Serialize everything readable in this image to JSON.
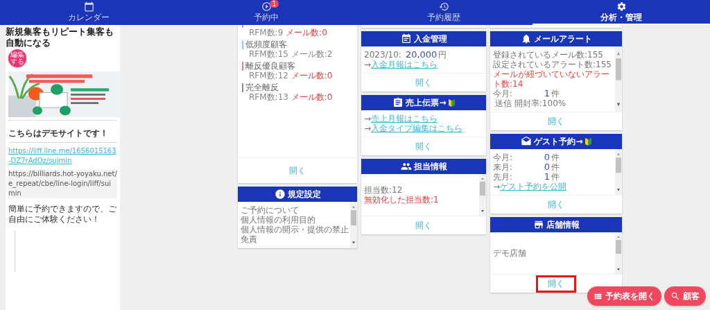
{
  "nav": {
    "tabs": [
      {
        "label": "カレンダー",
        "selected": false
      },
      {
        "label": "予約中",
        "badge": "1",
        "selected": false
      },
      {
        "label": "予約履歴",
        "selected": false
      },
      {
        "label": "分析・管理",
        "selected": true
      }
    ]
  },
  "sidebar": {
    "title": "新規集客もリピート集客も自動になる",
    "edit_badge": "編集する",
    "heading": "こちらはデモサイトです！",
    "link": "https://liff.line.me/1656015163-DZ7rAdOz/suimin",
    "code_url": "https://billiards.hot-yoyaku.net/e_repeat/cbe/line-login/liff/suimin",
    "message": "簡単に予約できますので、ご自由にご体験ください！"
  },
  "columns": [
    {
      "rfm_card": {
        "segments": [
          {
            "color": "#b39ddb",
            "rfm": "RFM数:9",
            "mail": "メール数:0",
            "alert": true
          },
          {
            "name": "低頻度顧客",
            "color": "#81d4fa",
            "rfm": "RFM数:15",
            "mail": "メール数:2",
            "alert": false
          },
          {
            "name": "離反優良顧客",
            "color": "#ef7f7f",
            "rfm": "RFM数:12",
            "mail": "メール数:0",
            "alert": true
          },
          {
            "name": "完全離反",
            "color": "#888888",
            "rfm": "RFM数:13",
            "mail": "メール数:0",
            "alert": true
          }
        ],
        "open": "開く"
      },
      "cards": [
        {
          "kind": "terms",
          "title": "規定設定",
          "scrollable": true,
          "lines": [
            {
              "kind": "text",
              "text": "ご予約について"
            },
            {
              "kind": "text",
              "text": "個人情報の利用目的"
            },
            {
              "kind": "text",
              "text": "個人情報の開示・提供の禁止"
            },
            {
              "kind": "text",
              "text": "免責"
            }
          ]
        }
      ]
    },
    {
      "cards": [
        {
          "kind": "payment",
          "title": "入金管理",
          "scrollable": false,
          "lines": [
            {
              "kind": "amount",
              "label": "2023/10:",
              "value": "20,000",
              "unit": "円"
            },
            {
              "kind": "link",
              "arrow": "→",
              "text": "入金月報はこちら"
            }
          ],
          "open": "開く",
          "highlighted": false
        },
        {
          "kind": "sales",
          "title": "売上伝票→",
          "beginner": true,
          "scrollable": false,
          "lines": [
            {
              "kind": "link",
              "arrow": "→",
              "text": "売上月報はこちら"
            },
            {
              "kind": "link",
              "arrow": "→",
              "text": "入金タイプ編集はこちら"
            }
          ],
          "open": "開く",
          "highlighted": false
        },
        {
          "kind": "staff",
          "title": "担当情報",
          "scrollable": true,
          "lines": [
            {
              "kind": "text",
              "text": "担当数:12"
            },
            {
              "kind": "alert",
              "text": "無効化した担当数:1"
            }
          ],
          "open": "開く",
          "highlighted": false
        }
      ]
    },
    {
      "cards": [
        {
          "kind": "mail_alert",
          "title": "メールアラート",
          "scrollable": true,
          "lines": [
            {
              "kind": "text",
              "text": "登録されているメール数:155"
            },
            {
              "kind": "text",
              "text": "設定されているアラート数:155"
            },
            {
              "kind": "alert",
              "text": "メールが紐づいていないアラート数:14"
            },
            {
              "kind": "amount",
              "label": "今月:",
              "value": "1",
              "unit": "件",
              "extra": "送信 開封率:100%"
            }
          ],
          "open": "開く",
          "highlighted": false
        },
        {
          "kind": "guest",
          "title": "ゲスト予約→",
          "beginner": true,
          "scrollable": true,
          "lines": [
            {
              "kind": "amount",
              "label": "今月:",
              "value": "0",
              "unit": "件"
            },
            {
              "kind": "amount",
              "label": "来月:",
              "value": "0",
              "unit": "件"
            },
            {
              "kind": "amount",
              "label": "先月:",
              "value": "1",
              "unit": "件"
            },
            {
              "kind": "link",
              "arrow": "→",
              "text": "ゲスト予約を公開"
            }
          ],
          "open": "開く",
          "highlighted": false
        },
        {
          "kind": "store",
          "title": "店舗情報",
          "scrollable": true,
          "lines": [
            {
              "kind": "text",
              "text": "デモ店舗"
            }
          ],
          "open": "開く",
          "highlighted": true
        }
      ]
    }
  ],
  "fab": [
    {
      "kind": "list",
      "label": "予約表を開く"
    },
    {
      "kind": "search",
      "label": "顧客"
    }
  ]
}
